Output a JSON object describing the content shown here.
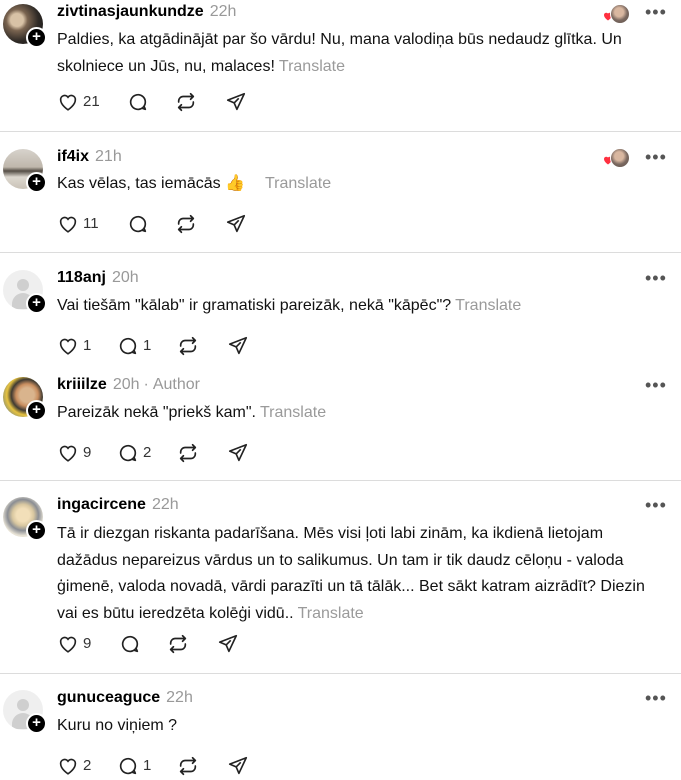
{
  "posts": [
    {
      "username": "zivtinasjaunkundze",
      "time": "22h",
      "text": "Paldies, ka atgādinājāt par šo vārdu! Nu, mana valodiņa būs nedaudz glītka. Un skolniece un Jūs, nu, malaces!",
      "translate": "Translate",
      "likes": "21"
    },
    {
      "username": "if4ix",
      "time": "21h",
      "text": "Kas vēlas, tas iemācās 👍",
      "translate": "Translate",
      "likes": "11"
    },
    {
      "username": "118anj",
      "time": "20h",
      "text": "Vai tiešām \"kālab\" ir gramatiski pareizāk, nekā \"kāpēc\"?",
      "translate": "Translate",
      "likes": "1",
      "replies": "1"
    },
    {
      "username": "kriiilze",
      "time": "20h",
      "author_label": "Author",
      "text": "Pareizāk nekā \"priekš kam\".",
      "translate": "Translate",
      "likes": "9",
      "replies": "2"
    },
    {
      "username": "ingacircene",
      "time": "22h",
      "text": "Tā ir diezgan riskanta padarīšana. Mēs visi ļoti labi zinām, ka ikdienā lietojam dažādus nepareizus vārdus un to salikumus. Un tam ir tik daudz cēloņu - valoda ģimenē, valoda novadā, vārdi parazīti un tā tālāk... Bet sākt katram aizrādīt? Diezin vai es būtu ieredzēta kolēģi vidū..",
      "translate": "Translate",
      "likes": "9"
    },
    {
      "username": "gunuceaguce",
      "time": "22h",
      "text": "Kuru no viņiem ?",
      "translate": "",
      "likes": "2",
      "replies": "1"
    }
  ],
  "colors": {
    "like_heart": "#ff3040",
    "muted": "#999999",
    "divider": "#dcdcdc"
  },
  "icons": [
    "heart-icon",
    "reply-icon",
    "repost-icon",
    "share-icon",
    "more-icon",
    "follow-plus-icon"
  ]
}
